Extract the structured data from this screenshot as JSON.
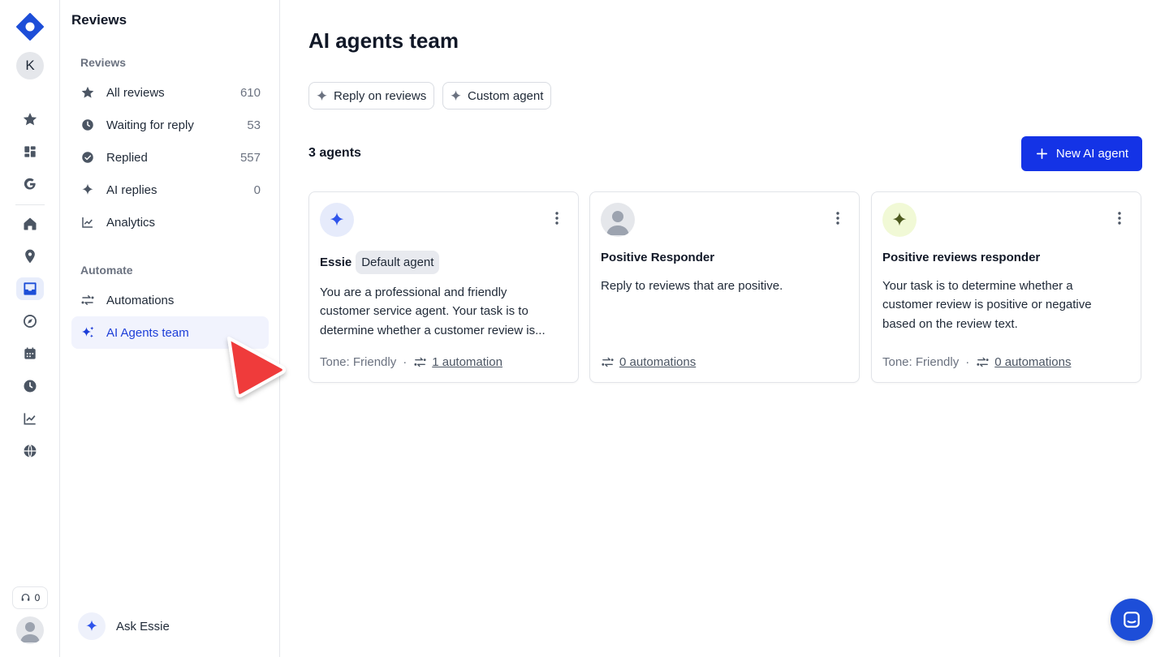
{
  "rail": {
    "avatar_initial": "K",
    "credits": "0",
    "icons": [
      "star-icon",
      "dashboard-icon",
      "google-icon",
      "home-icon",
      "location-pin-icon",
      "inbox-icon",
      "compass-icon",
      "calendar-icon",
      "clock-icon",
      "chart-line-icon",
      "globe-icon"
    ],
    "brand_color": "#1d4ed8"
  },
  "sidebar": {
    "title": "Reviews",
    "sections": {
      "reviews_label": "Reviews",
      "automate_label": "Automate"
    },
    "reviews_items": [
      {
        "label": "All reviews",
        "count": "610",
        "icon": "star-icon"
      },
      {
        "label": "Waiting for reply",
        "count": "53",
        "icon": "clock-icon"
      },
      {
        "label": "Replied",
        "count": "557",
        "icon": "check-circle-icon"
      },
      {
        "label": "AI replies",
        "count": "0",
        "icon": "sparkle-icon"
      },
      {
        "label": "Analytics",
        "count": "",
        "icon": "chart-line-icon"
      }
    ],
    "automate_items": [
      {
        "label": "Automations",
        "icon": "automation-icon"
      },
      {
        "label": "AI Agents team",
        "icon": "sparkles-icon",
        "active": true
      }
    ],
    "ask": "Ask Essie"
  },
  "main": {
    "title": "AI agents team",
    "chips": [
      "Reply on reviews",
      "Custom agent"
    ],
    "count": "3 agents",
    "new_button": "New AI agent",
    "accent": "#1433e6",
    "cards": [
      {
        "name": "Essie",
        "badge": "Default agent",
        "desc_lines": [
          "You are a professional and friendly",
          "customer service agent. Your task is to",
          "determine whether a customer review is..."
        ],
        "tone": "Tone: Friendly",
        "automations": "1 automation"
      },
      {
        "name": "Positive Responder",
        "desc_lines": [
          "Reply to reviews that are positive."
        ],
        "automations": "0 automations"
      },
      {
        "name": "Positive reviews responder",
        "desc_lines": [
          "Your task is to determine whether a",
          "customer review is positive or negative",
          "based on the review text."
        ],
        "tone": "Tone: Friendly",
        "automations": "0 automations"
      }
    ]
  }
}
